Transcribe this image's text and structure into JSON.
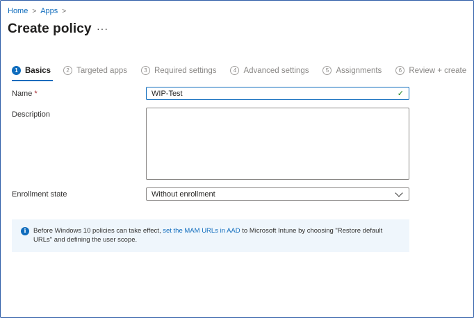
{
  "breadcrumb": {
    "home": "Home",
    "apps": "Apps",
    "separator": ">"
  },
  "page": {
    "title": "Create policy",
    "more": "···"
  },
  "steps": [
    {
      "num": "1",
      "label": "Basics"
    },
    {
      "num": "2",
      "label": "Targeted apps"
    },
    {
      "num": "3",
      "label": "Required settings"
    },
    {
      "num": "4",
      "label": "Advanced settings"
    },
    {
      "num": "5",
      "label": "Assignments"
    },
    {
      "num": "6",
      "label": "Review + create"
    }
  ],
  "form": {
    "name_label": "Name",
    "required_mark": "*",
    "name_value": "WIP-Test",
    "valid_icon": "✓",
    "description_label": "Description",
    "description_value": "",
    "enrollment_label": "Enrollment state",
    "enrollment_value": "Without enrollment"
  },
  "info": {
    "icon": "i",
    "text_before": "Before Windows 10 policies can take effect, ",
    "link_text": "set the MAM URLs in AAD",
    "text_after": " to Microsoft Intune by choosing \"Restore default URLs\" and defining the user scope."
  },
  "colors": {
    "accent": "#0f6cbd",
    "valid": "#107c10",
    "required": "#a4262c",
    "info_bg": "#eff6fc"
  }
}
